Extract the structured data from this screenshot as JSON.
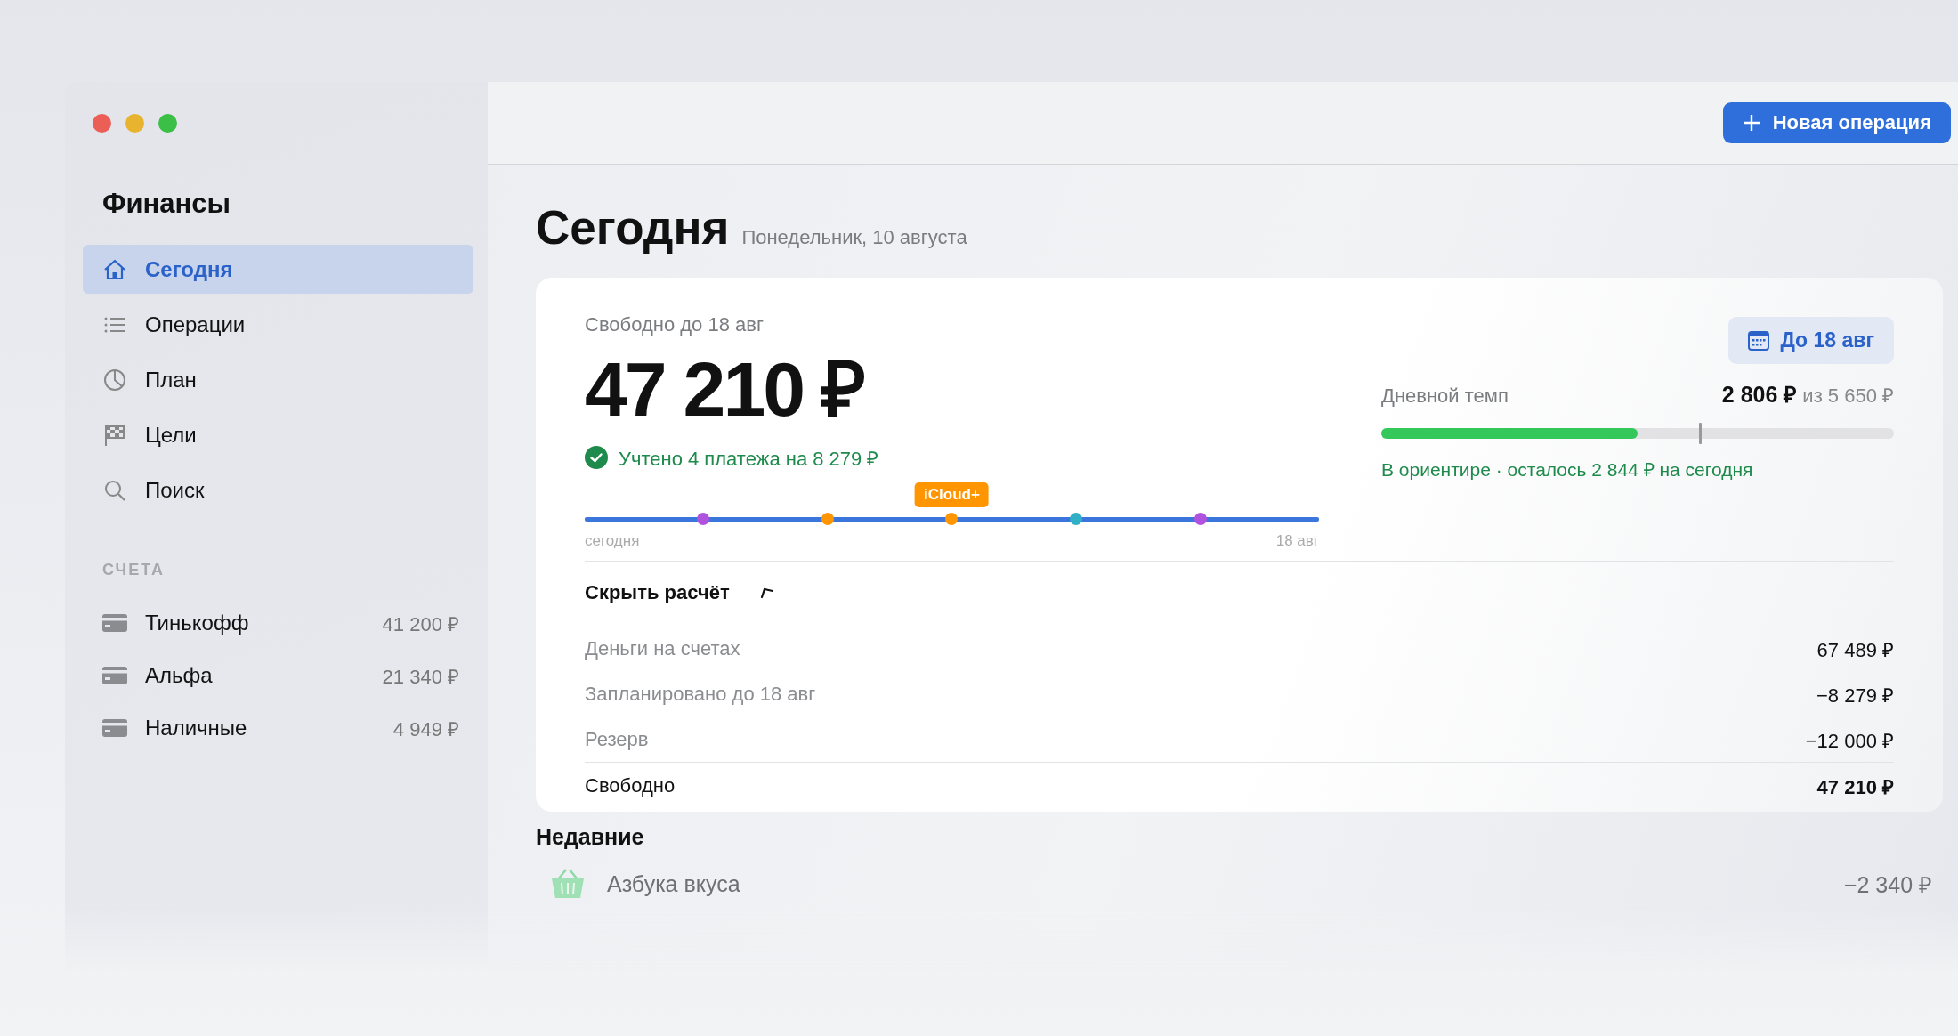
{
  "sidebar": {
    "title": "Финансы",
    "nav": [
      {
        "label": "Сегодня",
        "selected": true
      },
      {
        "label": "Операции",
        "selected": false
      },
      {
        "label": "План",
        "selected": false
      },
      {
        "label": "Цели",
        "selected": false
      },
      {
        "label": "Поиск",
        "selected": false
      }
    ],
    "accounts_heading": "СЧЕТА",
    "accounts": [
      {
        "name": "Тинькофф",
        "balance": "41 200 ₽"
      },
      {
        "name": "Альфа",
        "balance": "21 340 ₽"
      },
      {
        "name": "Наличные",
        "balance": "4 949 ₽"
      }
    ]
  },
  "toolbar": {
    "new_button": "Новая операция"
  },
  "header": {
    "title": "Сегодня",
    "date": "Понедельник, 10 августа"
  },
  "summary": {
    "caption": "Свободно до 18 авг",
    "amount": "47 210 ₽",
    "status": "Учтено 4 платежа на 8 279 ₽",
    "timeline": {
      "markers": [
        {
          "color": "#af52de"
        },
        {
          "color": "#ff9500"
        },
        {
          "color": "#ff9500",
          "label": "iCloud+"
        },
        {
          "color": "#30b0c7"
        },
        {
          "color": "#af52de"
        }
      ],
      "start_label": "сегодня",
      "end_label": "18 авг"
    },
    "period_button": "До 18 авг",
    "pace": {
      "label": "Дневной темп",
      "value": "2 806 ₽",
      "limit": "из 5 650 ₽",
      "level": 0.5,
      "target": {
        "level": 0.62
      },
      "status": "В ориентире · осталось 2 844 ₽ на сегодня"
    },
    "toggle": {
      "label": "Скрыть расчёт",
      "expanded": true
    },
    "breakdown": [
      {
        "kind": "item",
        "label": "Деньги на счетах",
        "value": "67 489 ₽"
      },
      {
        "kind": "item",
        "label": "Запланировано до 18 авг",
        "value": "−8 279 ₽"
      },
      {
        "kind": "item",
        "label": "Резерв",
        "value": "−12 000 ₽"
      },
      {
        "kind": "total",
        "label": "Свободно",
        "value": "47 210 ₽"
      }
    ]
  },
  "recent": {
    "title": "Недавние",
    "items": [
      {
        "name": "Азбука вкуса",
        "amount": "−2 340 ₽"
      }
    ]
  }
}
